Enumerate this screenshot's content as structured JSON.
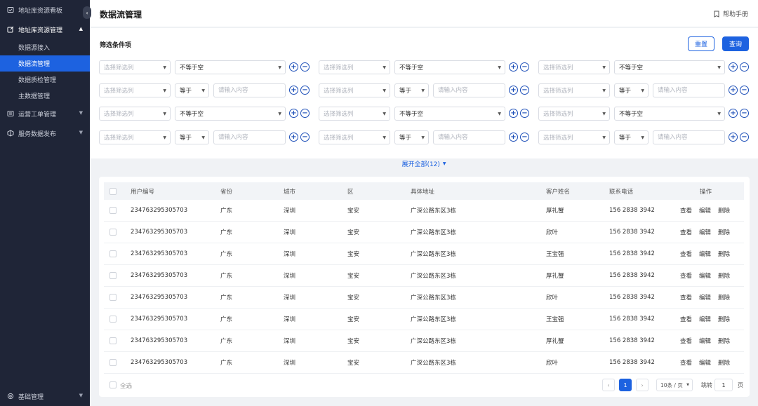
{
  "sidebar": {
    "top_item": "地址库资源看板",
    "groups": [
      {
        "label": "地址库资源管理",
        "open": true
      },
      {
        "label": "运营工单管理"
      },
      {
        "label": "服务数据发布"
      }
    ],
    "sub_items": [
      "数据源接入",
      "数据流管理",
      "数据质检管理",
      "主数据管理"
    ],
    "active_sub": "数据流管理",
    "bottom_item": "基础管理",
    "collapse_glyph": "‹"
  },
  "header": {
    "title": "数据流管理",
    "help_label": "帮助手册"
  },
  "filter": {
    "title": "筛选条件项",
    "reset_label": "重置",
    "query_label": "查询",
    "column_placeholder": "选择筛选列",
    "op_not_empty": "不等于空",
    "op_equals": "等于",
    "value_placeholder": "请输入内容",
    "plus": "+",
    "minus": "−",
    "expand_label": "展开全部(12)"
  },
  "table": {
    "headers": [
      "用户编号",
      "省份",
      "城市",
      "区",
      "具体地址",
      "客户姓名",
      "联系电话",
      "操作"
    ],
    "rows": [
      [
        "234763295305703",
        "广东",
        "深圳",
        "宝安",
        "广深公路东区3栋",
        "厚礼蟹",
        "156 2838 3942"
      ],
      [
        "234763295305703",
        "广东",
        "深圳",
        "宝安",
        "广深公路东区3栋",
        "欣叶",
        "156 2838 3942"
      ],
      [
        "234763295305703",
        "广东",
        "深圳",
        "宝安",
        "广深公路东区3栋",
        "王宝强",
        "156 2838 3942"
      ],
      [
        "234763295305703",
        "广东",
        "深圳",
        "宝安",
        "广深公路东区3栋",
        "厚礼蟹",
        "156 2838 3942"
      ],
      [
        "234763295305703",
        "广东",
        "深圳",
        "宝安",
        "广深公路东区3栋",
        "欣叶",
        "156 2838 3942"
      ],
      [
        "234763295305703",
        "广东",
        "深圳",
        "宝安",
        "广深公路东区3栋",
        "王宝强",
        "156 2838 3942"
      ],
      [
        "234763295305703",
        "广东",
        "深圳",
        "宝安",
        "广深公路东区3栋",
        "厚礼蟹",
        "156 2838 3942"
      ],
      [
        "234763295305703",
        "广东",
        "深圳",
        "宝安",
        "广深公路东区3栋",
        "欣叶",
        "156 2838 3942"
      ]
    ],
    "actions": [
      "查看",
      "编辑",
      "删除"
    ],
    "select_all_label": "全选"
  },
  "pagination": {
    "prev": "‹",
    "current_page": "1",
    "next": "›",
    "page_size": "10条 / 页",
    "jump_label": "跳转",
    "jump_value": "1",
    "page_label": "页"
  },
  "colors": {
    "primary": "#1d62e0",
    "sidebar_bg": "#1f2537"
  }
}
